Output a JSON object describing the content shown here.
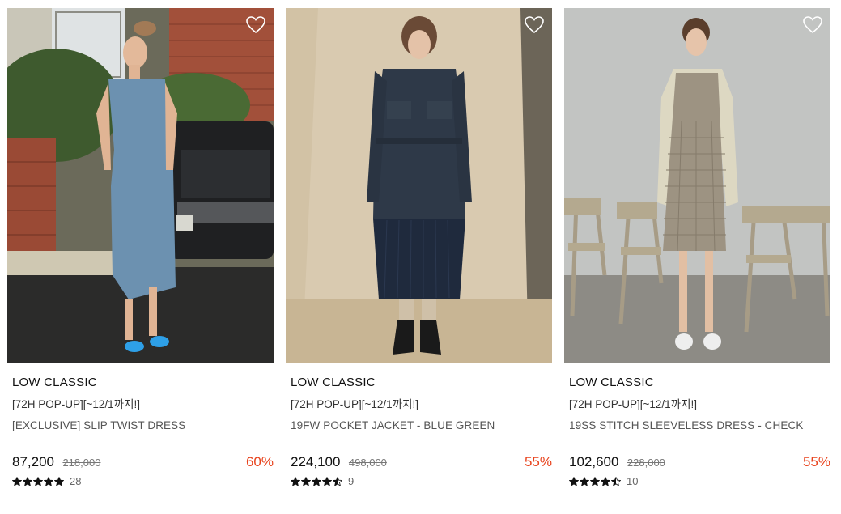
{
  "products": [
    {
      "brand": "LOW CLASSIC",
      "event": "[72H POP-UP][~12/1까지!]",
      "name": "[EXCLUSIVE] SLIP TWIST DRESS",
      "price": "87,200",
      "original_price": "218,000",
      "discount": "60%",
      "rating": 5,
      "review_count": "28",
      "image_description_icon": "product-photo"
    },
    {
      "brand": "LOW CLASSIC",
      "event": "[72H POP-UP][~12/1까지!]",
      "name": "19FW POCKET JACKET - BLUE GREEN",
      "price": "224,100",
      "original_price": "498,000",
      "discount": "55%",
      "rating": 4.5,
      "review_count": "9",
      "image_description_icon": "product-photo"
    },
    {
      "brand": "LOW CLASSIC",
      "event": "[72H POP-UP][~12/1까지!]",
      "name": "19SS STITCH SLEEVELESS DRESS - CHECK",
      "price": "102,600",
      "original_price": "228,000",
      "discount": "55%",
      "rating": 4.5,
      "review_count": "10",
      "image_description_icon": "product-photo"
    }
  ],
  "colors": {
    "discount": "#e8421c",
    "star": "#111111",
    "wishlist_icon": "#ffffff"
  },
  "icons": {
    "wishlist": "heart-icon",
    "rating": "star-icon"
  }
}
